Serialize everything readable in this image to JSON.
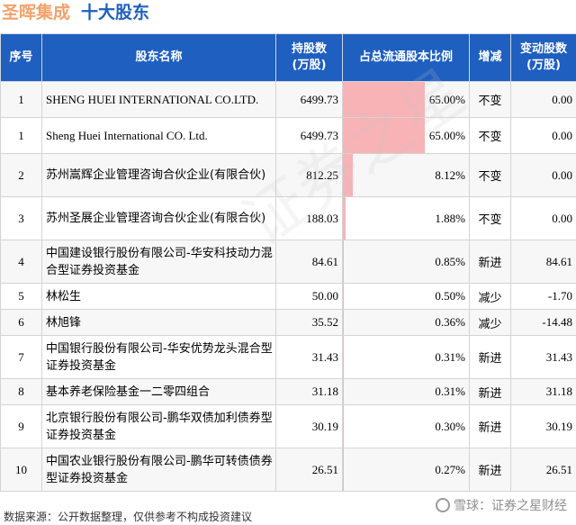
{
  "header": {
    "company": "圣晖集成",
    "section": "十大股东"
  },
  "table": {
    "columns": {
      "index": "序号",
      "name": "股东名称",
      "shares_line1": "持股数",
      "shares_line2": "(万股)",
      "ratio": "占总流通股本比例",
      "change_type": "增减",
      "delta_line1": "变动股数",
      "delta_line2": "(万股)"
    },
    "rows": [
      {
        "index": "1",
        "name": "SHENG HUEI INTERNATIONAL CO.LTD.",
        "shares": "6499.73",
        "ratio_text": "65.00%",
        "ratio": 65.0,
        "change": "不变",
        "change_kind": "unchanged",
        "delta": "0.00",
        "latin": true
      },
      {
        "index": "1",
        "name": "Sheng Huei International CO. Ltd.",
        "shares": "6499.73",
        "ratio_text": "65.00%",
        "ratio": 65.0,
        "change": "不变",
        "change_kind": "unchanged",
        "delta": "0.00",
        "latin": true
      },
      {
        "index": "2",
        "name": "苏州嵩辉企业管理咨询合伙企业(有限合伙)",
        "shares": "812.25",
        "ratio_text": "8.12%",
        "ratio": 8.12,
        "change": "不变",
        "change_kind": "unchanged",
        "delta": "0.00"
      },
      {
        "index": "3",
        "name": "苏州圣展企业管理咨询合伙企业(有限合伙)",
        "shares": "188.03",
        "ratio_text": "1.88%",
        "ratio": 1.88,
        "change": "不变",
        "change_kind": "unchanged",
        "delta": "0.00"
      },
      {
        "index": "4",
        "name": "中国建设银行股份有限公司-华安科技动力混合型证券投资基金",
        "shares": "84.61",
        "ratio_text": "0.85%",
        "ratio": 0.85,
        "change": "新进",
        "change_kind": "new",
        "delta": "84.61"
      },
      {
        "index": "5",
        "name": "林松生",
        "shares": "50.00",
        "ratio_text": "0.50%",
        "ratio": 0.5,
        "change": "减少",
        "change_kind": "decrease",
        "delta": "-1.70"
      },
      {
        "index": "6",
        "name": "林旭锋",
        "shares": "35.52",
        "ratio_text": "0.36%",
        "ratio": 0.36,
        "change": "减少",
        "change_kind": "decrease",
        "delta": "-14.48"
      },
      {
        "index": "7",
        "name": "中国银行股份有限公司-华安优势龙头混合型证券投资基金",
        "shares": "31.43",
        "ratio_text": "0.31%",
        "ratio": 0.31,
        "change": "新进",
        "change_kind": "new",
        "delta": "31.43"
      },
      {
        "index": "8",
        "name": "基本养老保险基金一二零四组合",
        "shares": "31.18",
        "ratio_text": "0.31%",
        "ratio": 0.31,
        "change": "新进",
        "change_kind": "new",
        "delta": "31.18"
      },
      {
        "index": "9",
        "name": "北京银行股份有限公司-鹏华双债加利债券型证券投资基金",
        "shares": "30.19",
        "ratio_text": "0.30%",
        "ratio": 0.3,
        "change": "新进",
        "change_kind": "new",
        "delta": "30.19"
      },
      {
        "index": "10",
        "name": "中国农业银行股份有限公司-鹏华可转债债券型证券投资基金",
        "shares": "26.51",
        "ratio_text": "0.27%",
        "ratio": 0.27,
        "change": "新进",
        "change_kind": "new",
        "delta": "26.51"
      }
    ]
  },
  "footer": {
    "source": "数据来源：公开数据整理，仅供参考不构成投资建议",
    "brand": "雪球：证券之星财经"
  },
  "watermark": "证券之星",
  "colors": {
    "header_bg": "#1f5fbf",
    "bar": "#f8b3b6",
    "positive": "#d42020",
    "negative": "#1a9b3c",
    "company_title": "#f2a26a",
    "section_title": "#1f5fbf"
  }
}
